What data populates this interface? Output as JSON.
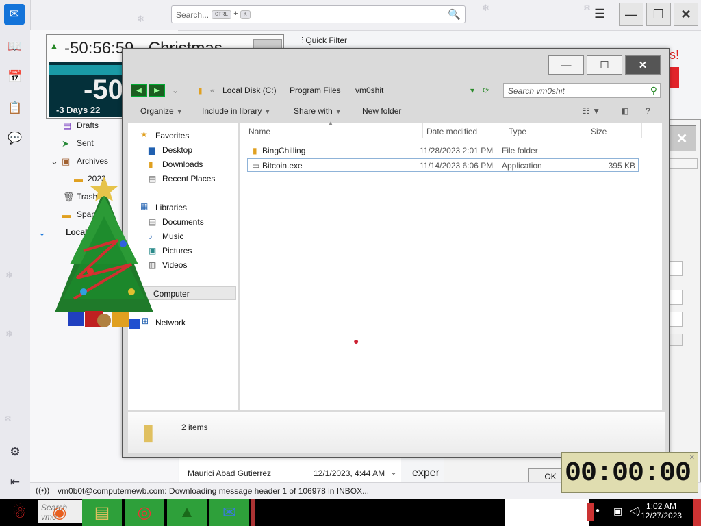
{
  "thunderbird": {
    "search_placeholder": "Search...",
    "shortcut_key1": "CTRL",
    "shortcut_plus": "+",
    "shortcut_key2": "K",
    "quick_filter": "Quick Filter",
    "folders": [
      "Drafts",
      "Sent",
      "Archives",
      "2023",
      "Trash",
      "Spam",
      "Local"
    ],
    "status": "vm0b0t@computernewb.com: Downloading message header 1 of 106978 in INBOX...",
    "message_sender": "Maurici Abad Gutierrez",
    "message_date": "12/1/2023, 4:44 AM",
    "preview_text": "exper",
    "ok_label": "OK"
  },
  "countdown": {
    "title": "-50:56:59 - Christmas",
    "big_number": "-50",
    "days_text": "-3 Days 22"
  },
  "explorer": {
    "breadcrumb": [
      "Local Disk (C:)",
      "Program Files",
      "vm0shit"
    ],
    "search_placeholder": "Search vm0shit",
    "toolbar": {
      "organize": "Organize",
      "include": "Include in library",
      "share": "Share with",
      "new_folder": "New folder"
    },
    "nav": {
      "favorites": "Favorites",
      "desktop": "Desktop",
      "downloads": "Downloads",
      "recent": "Recent Places",
      "libraries": "Libraries",
      "documents": "Documents",
      "music": "Music",
      "pictures": "Pictures",
      "videos": "Videos",
      "computer": "Computer",
      "network": "Network"
    },
    "columns": {
      "name": "Name",
      "date": "Date modified",
      "type": "Type",
      "size": "Size"
    },
    "files": [
      {
        "name": "BingChilling",
        "date": "11/28/2023 2:01 PM",
        "type": "File folder",
        "size": ""
      },
      {
        "name": "Bitcoin.exe",
        "date": "11/14/2023 6:06 PM",
        "type": "Application",
        "size": "395 KB"
      }
    ],
    "item_count": "2 items"
  },
  "gadget_clock": {
    "digits": "00:00:00"
  },
  "taskbar": {
    "search_text": "Search vm0",
    "time": "1:02 AM",
    "date": "12/27/2023"
  }
}
